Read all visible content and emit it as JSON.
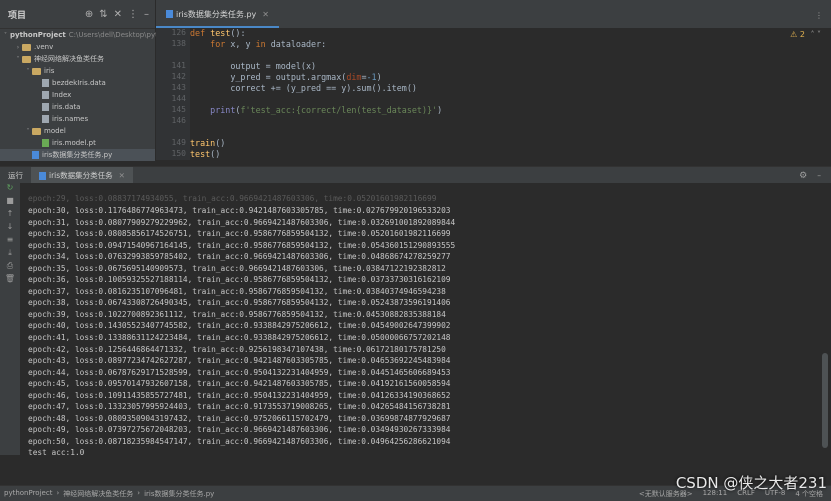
{
  "project": {
    "title": "项目",
    "tree": [
      {
        "label": "pythonProject",
        "path": "C:\\Users\\dell\\Desktop\\pyth",
        "indent": 0,
        "chev": "˅",
        "icon": "folder"
      },
      {
        "label": ".venv",
        "indent": 1,
        "chev": "›",
        "icon": "folder"
      },
      {
        "label": "神经网络解决鱼类任务",
        "indent": 1,
        "chev": "˅",
        "icon": "folder"
      },
      {
        "label": "iris",
        "indent": 2,
        "chev": "˅",
        "icon": "folder"
      },
      {
        "label": "bezdekIris.data",
        "indent": 3,
        "chev": "",
        "icon": "file"
      },
      {
        "label": "Index",
        "indent": 3,
        "chev": "",
        "icon": "file"
      },
      {
        "label": "iris.data",
        "indent": 3,
        "chev": "",
        "icon": "file"
      },
      {
        "label": "iris.names",
        "indent": 3,
        "chev": "",
        "icon": "file"
      },
      {
        "label": "model",
        "indent": 2,
        "chev": "˅",
        "icon": "folder"
      },
      {
        "label": "iris.model.pt",
        "indent": 3,
        "chev": "",
        "icon": "pt"
      },
      {
        "label": "iris数据集分类任务.py",
        "indent": 2,
        "chev": "",
        "icon": "py",
        "selected": true
      }
    ]
  },
  "editor": {
    "tab": "iris数据集分类任务.py",
    "warn_count": "2",
    "line_numbers": [
      "126",
      "138",
      "",
      "141",
      "142",
      "143",
      "144",
      "145",
      "146",
      "",
      "149",
      "150"
    ],
    "lines": [
      {
        "html": "<span class='kw'>def</span> <span class='fn'>test</span>():"
      },
      {
        "html": "    <span class='kw'>for</span> x, y <span class='kw'>in</span> dataloader:"
      },
      {
        "html": ""
      },
      {
        "html": "        output = model(x)"
      },
      {
        "html": "        y_pred = output.argmax(<span class='prm'>dim</span>=<span class='num'>-1</span>)"
      },
      {
        "html": "        correct += (y_pred == y).sum().item()"
      },
      {
        "html": ""
      },
      {
        "html": "    <span class='bi'>print</span>(<span class='str'>f'test_acc:{correct/len(test_dataset)}'</span>)"
      },
      {
        "html": ""
      },
      {
        "html": ""
      },
      {
        "html": "<span class='fn'>train</span>()"
      },
      {
        "html": "<span class='fn'>test</span>()"
      }
    ]
  },
  "run": {
    "label": "运行",
    "tab": "iris数据集分类任务",
    "output": [
      "epoch:30, loss:0.1176486774963473, train_acc:0.9421487603305785, time:0.027679920196533203",
      "epoch:31, loss:0.08077909279229962, train_acc:0.9669421487603306, time:0.032691001892089844",
      "epoch:32, loss:0.08085856174526751, train_acc:0.9586776859504132, time:0.05201601982116699",
      "epoch:33, loss:0.09471540967164145, train_acc:0.9586776859504132, time:0.054360151290893555",
      "epoch:34, loss:0.07632993859785402, train_acc:0.9669421487603306, time:0.04868674278259277",
      "epoch:35, loss:0.0675695140909573, train_acc:0.9669421487603306, time:0.03847122192382812",
      "epoch:36, loss:0.10059325527188114, train_acc:0.9586776859504132, time:0.03733730316162109",
      "epoch:37, loss:0.0816235107096481, train_acc:0.9586776859504132, time:0.03840374946594238",
      "epoch:38, loss:0.06743308726490345, train_acc:0.9586776859504132, time:0.05243873596191406",
      "epoch:39, loss:0.1022700892361112, train_acc:0.9586776859504132, time:0.04530882835388184",
      "epoch:40, loss:0.14305523407745582, train_acc:0.9338842975206612, time:0.04549002647399902",
      "epoch:41, loss:0.13388631124223484, train_acc:0.9338842975206612, time:0.05000066757202148",
      "epoch:42, loss:0.1256446864471332, train_acc:0.9256198347107438, time:0.06172180175781250",
      "epoch:43, loss:0.08977234742627287, train_acc:0.9421487603305785, time:0.04653692245483984",
      "epoch:44, loss:0.06787629171528599, train_acc:0.9504132231404959, time:0.04451465606689453",
      "epoch:45, loss:0.09570147932607158, train_acc:0.9421487603305785, time:0.04192161560058594",
      "epoch:46, loss:0.10911435855727481, train_acc:0.9504132231404959, time:0.04126334190368652",
      "epoch:47, loss:0.13323057995924403, train_acc:0.9173553719008265, time:0.04265484156738281",
      "epoch:48, loss:0.08093509043197432, train_acc:0.9752066115702479, time:0.03699874877929687",
      "epoch:49, loss:0.07397275672048203, train_acc:0.9669421487603306, time:0.03494930267333984",
      "epoch:50, loss:0.08718235984547147, train_acc:0.9669421487603306, time:0.04964256286621094",
      "test_acc:1.0",
      "",
      "进程已结束，退出代码为 0"
    ]
  },
  "status": {
    "crumbs": [
      "pythonProject",
      "›",
      "神经网络解决鱼类任务",
      "›",
      "iris数据集分类任务.py"
    ],
    "right": [
      "<无默认服务器>",
      "128:11",
      "CRLF",
      "UTF-8",
      "4 个空格"
    ]
  },
  "watermark": "CSDN @侠之大者231"
}
